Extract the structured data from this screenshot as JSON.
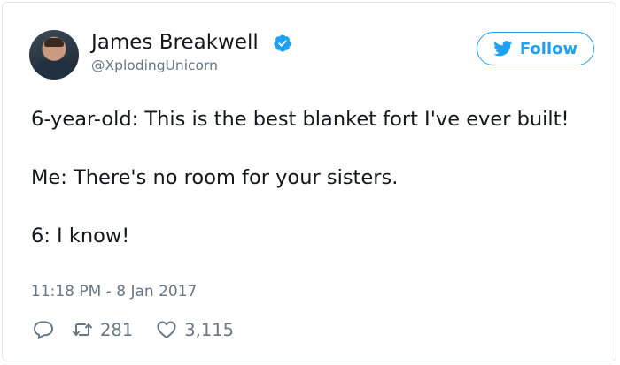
{
  "user": {
    "name": "James Breakwell",
    "handle": "@XplodingUnicorn",
    "verified": true
  },
  "follow_button": {
    "label": "Follow",
    "icon": "twitter-bird-icon"
  },
  "tweet": {
    "lines": [
      "6-year-old: This is the best blanket fort I've ever built!",
      "Me: There's no room for your sisters.",
      "6: I know!"
    ],
    "timestamp": "11:18 PM - 8 Jan 2017"
  },
  "actions": {
    "reply_icon": "reply-icon",
    "retweet_icon": "retweet-icon",
    "retweet_count": "281",
    "like_icon": "heart-icon",
    "like_count": "3,115"
  },
  "colors": {
    "accent": "#1da1f2",
    "secondary_text": "#657786",
    "border": "#e1e8ed"
  }
}
